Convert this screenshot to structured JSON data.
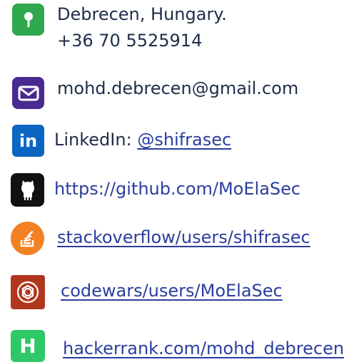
{
  "contact": {
    "location_line1": "Debrecen, Hungary.",
    "location_line2": "+36 70 5525914",
    "email": "mohd.debrecen@gmail.com",
    "linkedin_label": "LinkedIn:",
    "linkedin_handle": "@shifrasec",
    "github": "https://github.com/MoElaSec",
    "stackoverflow": "stackoverflow/users/shifrasec",
    "codewars": "codewars/users/MoElaSec",
    "hackerrank": "hackerrank.com/mohd_debrecen"
  },
  "icons": {
    "location": "map-pin-icon",
    "email": "envelope-icon",
    "linkedin": "linkedin-icon",
    "github": "github-icon",
    "stackoverflow": "stackoverflow-icon",
    "codewars": "codewars-icon",
    "hackerrank": "hackerrank-icon"
  },
  "colors": {
    "location": "#2fa84f",
    "email": "#4a2a8f",
    "linkedin": "#0a66c2",
    "github": "#111111",
    "stackoverflow": "#f48024",
    "codewars": "#b1361e",
    "hackerrank": "#2ec866"
  }
}
